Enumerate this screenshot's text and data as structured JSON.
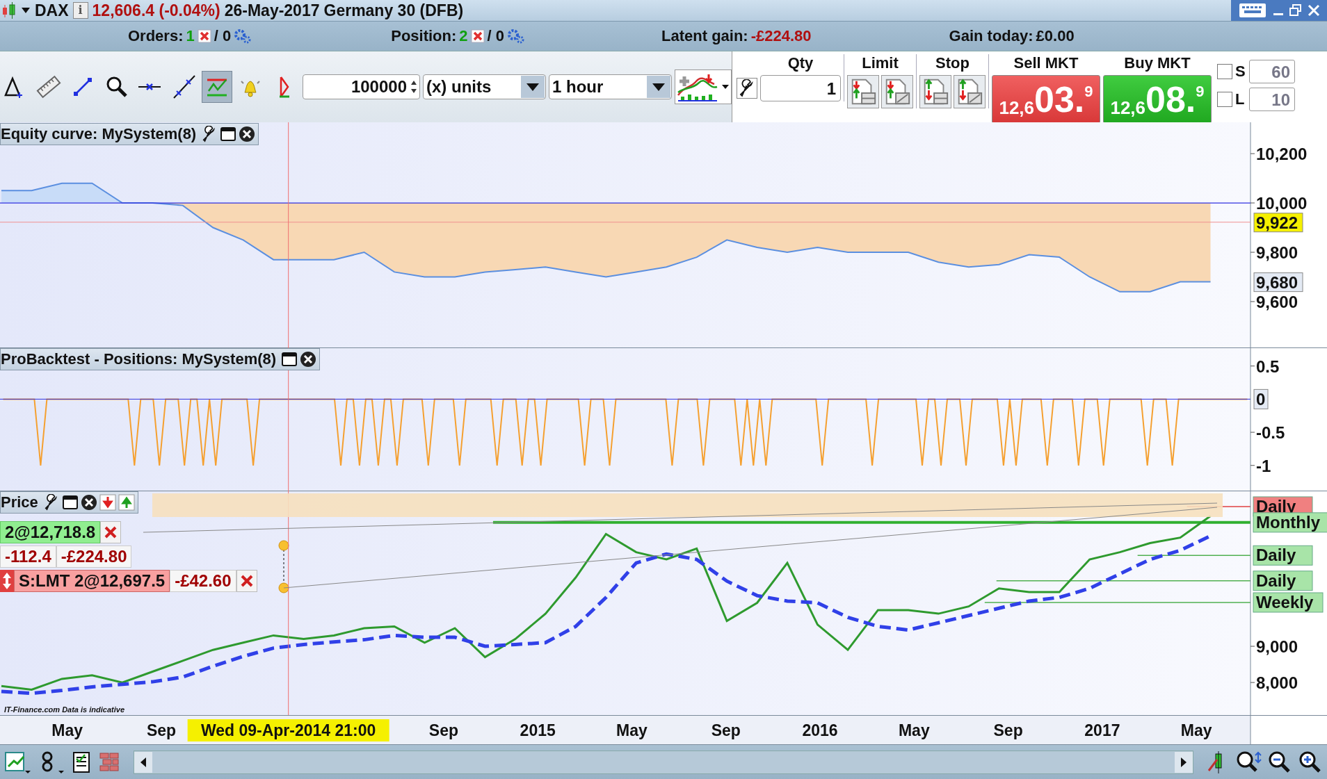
{
  "title_bar": {
    "symbol": "DAX",
    "info": "i",
    "price": "12,606.4 (-0.04%)",
    "date": "26-May-2017",
    "instrument": "Germany 30 (DFB)"
  },
  "summary_bar": {
    "orders_label": "Orders:",
    "orders_count": "1",
    "orders_pending": "/ 0",
    "position_label": "Position:",
    "position_count": "2",
    "position_pending": "/ 0",
    "latent_label": "Latent gain:",
    "latent_value": "-£224.80",
    "today_label": "Gain today:",
    "today_value": "£0.00"
  },
  "toolbar": {
    "tools": [
      {
        "kind": "triangle",
        "selected": false
      },
      {
        "kind": "ruler",
        "selected": false
      },
      {
        "kind": "segment",
        "selected": false
      },
      {
        "kind": "zoom",
        "selected": false
      },
      {
        "kind": "hline",
        "selected": false
      },
      {
        "kind": "line",
        "selected": false
      },
      {
        "kind": "channel",
        "selected": true
      },
      {
        "kind": "alert",
        "selected": false
      },
      {
        "kind": "fib",
        "selected": false
      }
    ],
    "quantity": "100000",
    "unit": "(x) units",
    "timeframe": "1 hour"
  },
  "trade_panel": {
    "qty_label": "Qty",
    "qty": "1",
    "limit_label": "Limit",
    "stop_label": "Stop",
    "sell_label": "Sell MKT",
    "sell": {
      "prefix": "12,6",
      "main": "03.",
      "sup": "9"
    },
    "buy_label": "Buy MKT",
    "buy": {
      "prefix": "12,6",
      "main": "08.",
      "sup": "9"
    },
    "stops": [
      {
        "label": "S",
        "value": "60",
        "checked": false
      },
      {
        "label": "L",
        "value": "10",
        "checked": false
      }
    ]
  },
  "equity_panel": {
    "value_labels": [
      {
        "kind": "crosshair",
        "label": "9,922"
      },
      {
        "kind": "last",
        "label": "9,680"
      }
    ],
    "chart_data": {
      "type": "line",
      "title": "Equity curve: MySystem(8)",
      "series": [
        {
          "color": "#5b8fe0",
          "values": [
            10050,
            10050,
            10080,
            10080,
            10000,
            10000,
            9990,
            9900,
            9850,
            9770,
            9770,
            9770,
            9800,
            9720,
            9700,
            9700,
            9720,
            9730,
            9740,
            9720,
            9700,
            9720,
            9740,
            9780,
            9850,
            9820,
            9800,
            9820,
            9800,
            9800,
            9800,
            9760,
            9740,
            9750,
            9790,
            9780,
            9700,
            9640,
            9640,
            9680,
            9680
          ]
        }
      ],
      "ylim": [
        9414,
        10327
      ],
      "yticks": [
        {
          "value": 10200,
          "label": "10,200"
        },
        {
          "value": 10000,
          "label": "10,000"
        },
        {
          "value": 9800,
          "label": "9,800"
        },
        {
          "value": 9600,
          "label": "9,600"
        }
      ]
    }
  },
  "positions_panel": {
    "value_label": "0",
    "chart_data": {
      "type": "line",
      "title": "ProBacktest - Positions: MySystem(8)",
      "series": [
        {
          "color": "#f5a030",
          "values": [
            0,
            0,
            0,
            0,
            0,
            0,
            -1,
            0,
            0,
            0,
            0,
            0,
            0,
            0,
            0,
            0,
            0,
            0,
            0,
            0,
            0,
            -1,
            0,
            0,
            0,
            -1,
            0,
            0,
            0,
            -1,
            0,
            0,
            -1,
            0,
            -1,
            0,
            0,
            0,
            0,
            0,
            -1,
            0,
            0,
            0,
            0,
            0,
            0,
            0,
            0,
            0,
            0,
            0,
            0,
            0,
            -1,
            0,
            0,
            -1,
            0,
            0,
            -1,
            0,
            0,
            -1,
            0,
            0,
            0,
            0,
            -1,
            0,
            0,
            0,
            0,
            -1,
            0,
            0,
            0,
            0,
            0,
            -1,
            0,
            0,
            0,
            -1,
            0,
            0,
            -1,
            0,
            0,
            0,
            0,
            0,
            0,
            -1,
            0,
            0,
            0,
            -1,
            0,
            0,
            0,
            0,
            0,
            0,
            0,
            0,
            0,
            -1,
            0,
            0,
            0,
            0,
            -1,
            0,
            0,
            0,
            0,
            0,
            -1,
            0,
            -1,
            0,
            -1,
            0,
            0,
            0,
            0,
            0,
            0,
            0,
            0,
            -1,
            0,
            0,
            0,
            0,
            0,
            0,
            0,
            -1,
            0,
            0,
            0,
            0,
            0,
            0,
            0,
            -1,
            0,
            0,
            -1,
            0,
            0,
            0,
            -1,
            0,
            0,
            0,
            0,
            0,
            -1,
            0,
            -1,
            0,
            0,
            0,
            0,
            -1,
            0,
            0,
            0,
            0,
            -1,
            0,
            0,
            0,
            -1,
            0,
            0,
            0,
            0,
            0,
            0,
            -1,
            0,
            0,
            0,
            -1,
            0,
            0,
            0,
            0,
            0,
            0,
            0,
            0,
            0,
            0,
            0,
            0
          ]
        }
      ],
      "ylim": [
        -1.38,
        0.78
      ],
      "yticks": [
        {
          "value": 0.5,
          "label": "0.5"
        },
        {
          "value": -0.5,
          "label": "-0.5"
        },
        {
          "value": -1,
          "label": "-1"
        }
      ]
    }
  },
  "price_panel": {
    "notice": "IT-Finance.com Data is indicative",
    "orders": [
      {
        "kind": "position",
        "text": "2@12,718.8"
      },
      {
        "kind": "pnl",
        "points": "-112.4",
        "amount": "-£224.80"
      },
      {
        "kind": "order",
        "text": "S:LMT 2@12,697.5",
        "amount": "-£42.60"
      }
    ],
    "levels": [
      {
        "label": "Daily",
        "color": "#f08080"
      },
      {
        "label": "Monthly",
        "color": "#a8e4a8"
      },
      {
        "label": "Daily",
        "color": "#a8e4a8"
      },
      {
        "label": "Daily",
        "color": "#a8e4a8"
      },
      {
        "label": "Weekly",
        "color": "#a8e4a8"
      }
    ],
    "chart_data": {
      "type": "line",
      "title": "Price",
      "series": [
        {
          "color": "#2e9a2e",
          "values": [
            7900,
            7800,
            8100,
            8200,
            8000,
            8300,
            8600,
            8900,
            9100,
            9300,
            9200,
            9300,
            9500,
            9550,
            9100,
            9500,
            8700,
            9200,
            9900,
            10900,
            12100,
            11600,
            11400,
            11700,
            9700,
            10200,
            11300,
            9600,
            8900,
            10000,
            10000,
            9900,
            10100,
            10600,
            10500,
            10500,
            11400,
            11600,
            11850,
            12000,
            12600
          ]
        },
        {
          "color": "#3040e8",
          "line_style": "dashed",
          "values": [
            7750,
            7700,
            7780,
            7880,
            7950,
            8020,
            8150,
            8450,
            8720,
            8950,
            9050,
            9120,
            9180,
            9300,
            9250,
            9250,
            9000,
            9050,
            9100,
            9550,
            10350,
            11300,
            11550,
            11400,
            10800,
            10400,
            10250,
            10200,
            9800,
            9550,
            9450,
            9650,
            9850,
            10050,
            10250,
            10350,
            10600,
            11000,
            11400,
            11650,
            12050
          ]
        }
      ],
      "ylim": [
        7100,
        13300
      ],
      "yticks": [
        {
          "value": 9000,
          "label": "9,000"
        },
        {
          "value": 8000,
          "label": "8,000"
        }
      ]
    }
  },
  "time_axis": {
    "labels": [
      "May",
      "Sep",
      "Sep",
      "2015",
      "May",
      "Sep",
      "2016",
      "May",
      "Sep",
      "2017",
      "May"
    ],
    "crosshair_label": "Wed 09-Apr-2014 21:00"
  }
}
